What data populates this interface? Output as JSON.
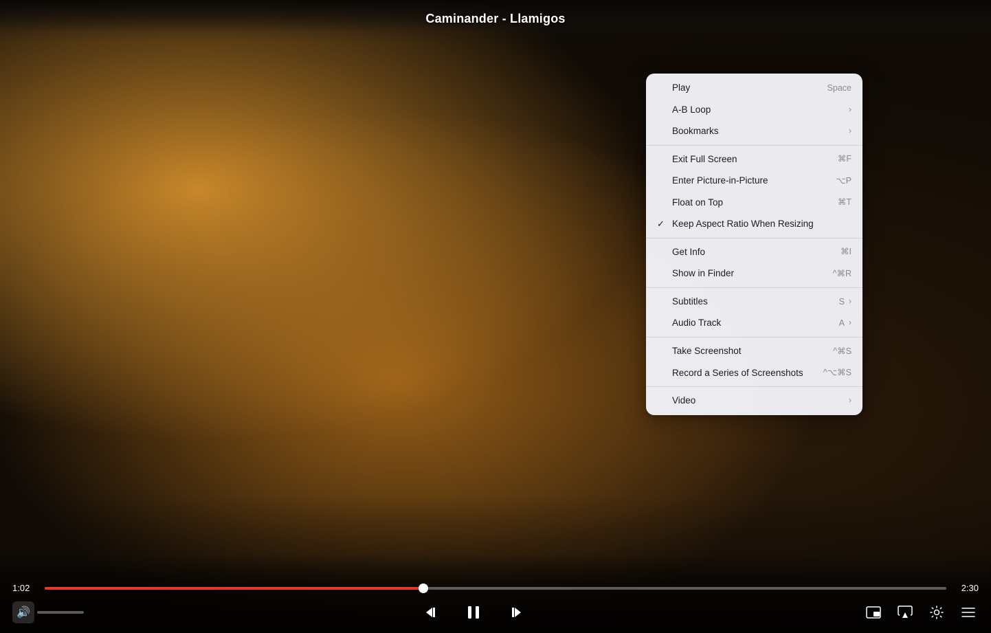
{
  "player": {
    "title": "Caminander - Llamigos",
    "time_current": "1:02",
    "time_total": "2:30",
    "progress_percent": 42
  },
  "controls": {
    "volume_icon": "🔊",
    "skip_back_label": "skip-back",
    "pause_label": "pause",
    "skip_forward_label": "skip-forward",
    "airplay_label": "airplay",
    "settings_label": "settings",
    "playlist_label": "playlist",
    "pip_label": "picture-in-picture"
  },
  "context_menu": {
    "items": [
      {
        "id": "play",
        "label": "Play",
        "shortcut": "Space",
        "has_submenu": false,
        "checked": false,
        "shortcut_symbol": ""
      },
      {
        "id": "ab-loop",
        "label": "A-B Loop",
        "shortcut": "",
        "has_submenu": true,
        "checked": false,
        "shortcut_symbol": ""
      },
      {
        "id": "bookmarks",
        "label": "Bookmarks",
        "shortcut": "",
        "has_submenu": true,
        "checked": false,
        "shortcut_symbol": ""
      },
      {
        "id": "sep1",
        "type": "separator"
      },
      {
        "id": "exit-fullscreen",
        "label": "Exit Full Screen",
        "shortcut": "⌘F",
        "has_submenu": false,
        "checked": false
      },
      {
        "id": "enter-pip",
        "label": "Enter Picture-in-Picture",
        "shortcut": "⌥P",
        "has_submenu": false,
        "checked": false
      },
      {
        "id": "float-on-top",
        "label": "Float on Top",
        "shortcut": "⌘T",
        "has_submenu": false,
        "checked": false
      },
      {
        "id": "keep-aspect",
        "label": "Keep Aspect Ratio When Resizing",
        "shortcut": "",
        "has_submenu": false,
        "checked": true
      },
      {
        "id": "sep2",
        "type": "separator"
      },
      {
        "id": "get-info",
        "label": "Get Info",
        "shortcut": "⌘I",
        "has_submenu": false,
        "checked": false
      },
      {
        "id": "show-finder",
        "label": "Show in Finder",
        "shortcut": "^⌘R",
        "has_submenu": false,
        "checked": false
      },
      {
        "id": "sep3",
        "type": "separator"
      },
      {
        "id": "subtitles",
        "label": "Subtitles",
        "shortcut": "S",
        "has_submenu": true,
        "checked": false
      },
      {
        "id": "audio-track",
        "label": "Audio Track",
        "shortcut": "A",
        "has_submenu": true,
        "checked": false
      },
      {
        "id": "sep4",
        "type": "separator"
      },
      {
        "id": "take-screenshot",
        "label": "Take Screenshot",
        "shortcut": "^⌘S",
        "has_submenu": false,
        "checked": false
      },
      {
        "id": "record-screenshots",
        "label": "Record a Series of Screenshots",
        "shortcut": "^⌥⌘S",
        "has_submenu": false,
        "checked": false
      },
      {
        "id": "sep5",
        "type": "separator"
      },
      {
        "id": "video",
        "label": "Video",
        "shortcut": "",
        "has_submenu": true,
        "checked": false
      }
    ]
  }
}
